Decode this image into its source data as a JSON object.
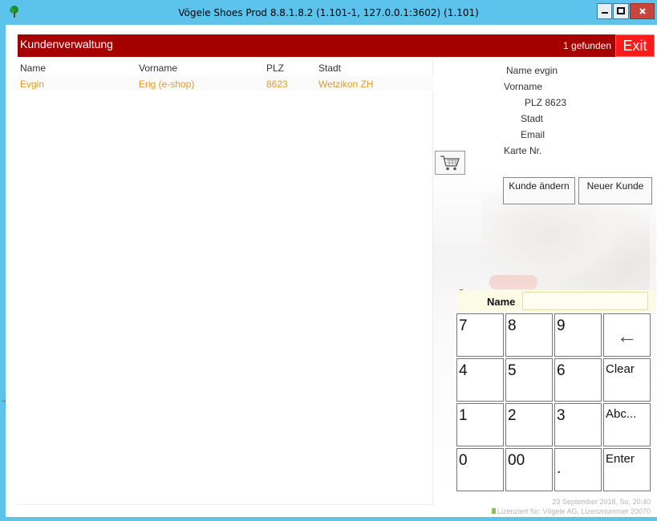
{
  "window": {
    "title": "Vögele Shoes Prod 8.8.1.8.2 (1.101-1, 127.0.0.1:3602) (1.101)",
    "colors": {
      "titlebar": "#5bc3ec",
      "header": "#a50000",
      "exit": "#ff1a1a",
      "row_text": "#e29a2a"
    }
  },
  "header": {
    "title": "Kundenverwaltung",
    "found": "1 gefunden",
    "exit_label": "Exit"
  },
  "table": {
    "columns": [
      "Name",
      "Vorname",
      "PLZ",
      "Stadt"
    ],
    "rows": [
      {
        "name": "Evgin",
        "vorname": "Erig (e-shop)",
        "plz": "8623",
        "stadt": "Wetzikon ZH"
      }
    ]
  },
  "details": {
    "name_line": "Name evgin",
    "vorname_label": "Vorname",
    "plz_line": "PLZ 8623",
    "stadt_label": "Stadt",
    "email_label": "Email",
    "karte_label": "Karte Nr."
  },
  "actions": {
    "edit_label": "Kunde ändern",
    "new_label": "Neuer Kunde",
    "cart_icon": "shopping-cart-icon"
  },
  "search": {
    "label": "Name",
    "value": ""
  },
  "keypad": {
    "keys": [
      "7",
      "8",
      "9",
      "←",
      "4",
      "5",
      "6",
      "Clear",
      "1",
      "2",
      "3",
      "Abc...",
      "0",
      "00",
      ".",
      "Enter"
    ]
  },
  "footer": {
    "date": "23 September 2018, So, 20:40",
    "license": "Lizenziert für: Vögele AG, Lizenznummer 20070"
  }
}
